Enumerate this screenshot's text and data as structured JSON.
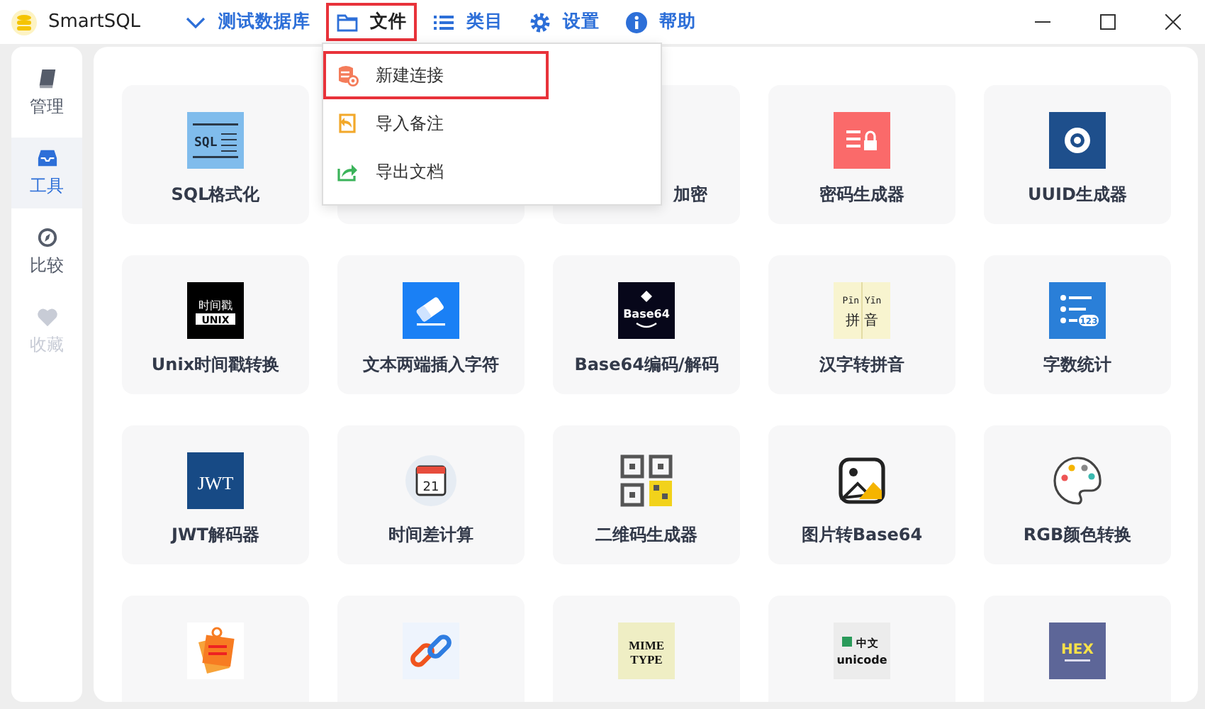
{
  "window": {
    "title": "SmartSQL"
  },
  "menu_bar": [
    {
      "kind": "dropdown",
      "label": "测试数据库",
      "open": false
    },
    {
      "kind": "folder",
      "label": "文件",
      "open": true
    },
    {
      "kind": "list",
      "label": "类目",
      "open": false
    },
    {
      "kind": "gear",
      "label": "设置",
      "open": false
    },
    {
      "kind": "info",
      "label": "帮助",
      "open": false
    }
  ],
  "file_menu": [
    {
      "kind": "db",
      "label": "新建连接",
      "boxed": true
    },
    {
      "kind": "import",
      "label": "导入备注",
      "boxed": false
    },
    {
      "kind": "export",
      "label": "导出文档",
      "boxed": false
    }
  ],
  "sidebar": [
    {
      "kind": "book",
      "label": "管理",
      "selected": false,
      "disabled": false
    },
    {
      "kind": "tray",
      "label": "工具",
      "selected": true,
      "disabled": false
    },
    {
      "kind": "compass",
      "label": "比较",
      "selected": false,
      "disabled": false
    },
    {
      "kind": "heart",
      "label": "收藏",
      "selected": false,
      "disabled": true
    }
  ],
  "tools": [
    {
      "kind": "sql",
      "icon_text": [
        "SQL"
      ],
      "label": "SQL格式化"
    },
    {
      "kind": "hidden"
    },
    {
      "kind": "hidden",
      "label": "加密",
      "cut": true
    },
    {
      "kind": "lock",
      "label": "密码生成器"
    },
    {
      "kind": "ring",
      "label": "UUID生成器"
    },
    {
      "kind": "unix",
      "icon_text": [
        "时间戳",
        "UNIX"
      ],
      "label": "Unix时间戳转换"
    },
    {
      "kind": "eraser",
      "label": "文本两端插入字符"
    },
    {
      "kind": "base64",
      "icon_text": [
        "Base64"
      ],
      "label": "Base64编码/解码"
    },
    {
      "kind": "pinyin",
      "icon_text": [
        "Pīn Yīn",
        "拼 音"
      ],
      "label": "汉字转拼音"
    },
    {
      "kind": "count",
      "icon_text": [
        "123"
      ],
      "label": "字数统计"
    },
    {
      "kind": "jwt",
      "icon_text": [
        "JWT"
      ],
      "label": "JWT解码器"
    },
    {
      "kind": "calendar",
      "icon_text": [
        "21"
      ],
      "label": "时间差计算"
    },
    {
      "kind": "qr",
      "label": "二维码生成器"
    },
    {
      "kind": "image",
      "label": "图片转Base64"
    },
    {
      "kind": "palette",
      "label": "RGB颜色转换"
    },
    {
      "kind": "notes"
    },
    {
      "kind": "link"
    },
    {
      "kind": "mime",
      "icon_text": [
        "MIME",
        "TYPE"
      ]
    },
    {
      "kind": "unicode",
      "icon_text": [
        "中文",
        "unicode"
      ]
    },
    {
      "kind": "hex",
      "icon_text": [
        "HEX"
      ]
    }
  ]
}
